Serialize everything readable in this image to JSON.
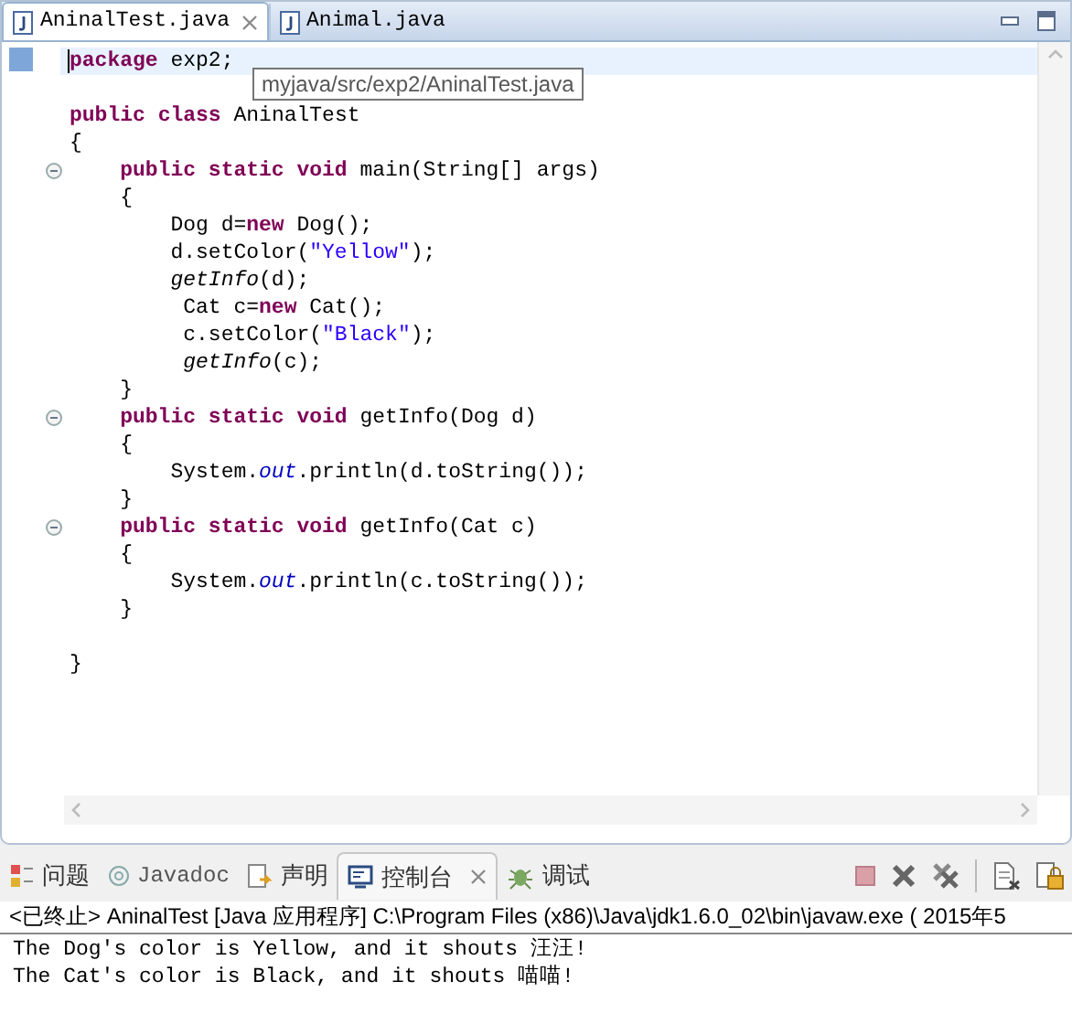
{
  "editor_tabs": [
    {
      "label": "AninalTest.java",
      "selected": true,
      "closable": true
    },
    {
      "label": "Animal.java",
      "selected": false,
      "closable": false
    }
  ],
  "code_lines": [
    {
      "kind": "code",
      "current": true,
      "tokens": [
        {
          "text": "package",
          "kind": "keyword"
        },
        {
          "text": " exp2;",
          "kind": "plain"
        }
      ]
    },
    {
      "kind": "blank"
    },
    {
      "kind": "code",
      "current": false,
      "tokens": [
        {
          "text": "public",
          "kind": "keyword"
        },
        {
          "text": " class",
          "kind": "keyword"
        },
        {
          "text": " AninalTest",
          "kind": "plain"
        }
      ]
    },
    {
      "kind": "code",
      "current": false,
      "tokens": [
        {
          "text": "{",
          "kind": "plain"
        }
      ]
    },
    {
      "kind": "fold_start",
      "current": false,
      "tokens": [
        {
          "text": "    public",
          "kind": "keyword"
        },
        {
          "text": " static",
          "kind": "keyword"
        },
        {
          "text": " void",
          "kind": "keyword"
        },
        {
          "text": " main(String[] args)",
          "kind": "plain"
        }
      ]
    },
    {
      "kind": "code",
      "current": false,
      "tokens": [
        {
          "text": "    {",
          "kind": "plain"
        }
      ]
    },
    {
      "kind": "code",
      "current": false,
      "tokens": [
        {
          "text": "        Dog d=",
          "kind": "plain"
        },
        {
          "text": "new",
          "kind": "keyword"
        },
        {
          "text": " Dog();",
          "kind": "plain"
        }
      ]
    },
    {
      "kind": "code",
      "current": false,
      "tokens": [
        {
          "text": "        d.setColor(",
          "kind": "plain"
        },
        {
          "text": "\"Yellow\"",
          "kind": "string"
        },
        {
          "text": ");",
          "kind": "plain"
        }
      ]
    },
    {
      "kind": "code",
      "current": false,
      "tokens": [
        {
          "text": "        getInfo",
          "kind": "static_call"
        },
        {
          "text": "(d);",
          "kind": "plain"
        }
      ]
    },
    {
      "kind": "code",
      "current": false,
      "tokens": [
        {
          "text": "         Cat c=",
          "kind": "plain"
        },
        {
          "text": "new",
          "kind": "keyword"
        },
        {
          "text": " Cat();",
          "kind": "plain"
        }
      ]
    },
    {
      "kind": "code",
      "current": false,
      "tokens": [
        {
          "text": "         c.setColor(",
          "kind": "plain"
        },
        {
          "text": "\"Black\"",
          "kind": "string"
        },
        {
          "text": ");",
          "kind": "plain"
        }
      ]
    },
    {
      "kind": "code",
      "current": false,
      "tokens": [
        {
          "text": "         getInfo",
          "kind": "static_call"
        },
        {
          "text": "(c);",
          "kind": "plain"
        }
      ]
    },
    {
      "kind": "code",
      "current": false,
      "tokens": [
        {
          "text": "    }",
          "kind": "plain"
        }
      ]
    },
    {
      "kind": "fold_start",
      "current": false,
      "tokens": [
        {
          "text": "    public",
          "kind": "keyword"
        },
        {
          "text": " static",
          "kind": "keyword"
        },
        {
          "text": " void",
          "kind": "keyword"
        },
        {
          "text": " getInfo(Dog d)",
          "kind": "plain"
        }
      ]
    },
    {
      "kind": "code",
      "current": false,
      "tokens": [
        {
          "text": "    {",
          "kind": "plain"
        }
      ]
    },
    {
      "kind": "code",
      "current": false,
      "tokens": [
        {
          "text": "        System.",
          "kind": "plain"
        },
        {
          "text": "out",
          "kind": "static_field"
        },
        {
          "text": ".println(d.toString());",
          "kind": "plain"
        }
      ]
    },
    {
      "kind": "code",
      "current": false,
      "tokens": [
        {
          "text": "    }",
          "kind": "plain"
        }
      ]
    },
    {
      "kind": "fold_start",
      "current": false,
      "tokens": [
        {
          "text": "    public",
          "kind": "keyword"
        },
        {
          "text": " static",
          "kind": "keyword"
        },
        {
          "text": " void",
          "kind": "keyword"
        },
        {
          "text": " getInfo(Cat c)",
          "kind": "plain"
        }
      ]
    },
    {
      "kind": "code",
      "current": false,
      "tokens": [
        {
          "text": "    {",
          "kind": "plain"
        }
      ]
    },
    {
      "kind": "code",
      "current": false,
      "tokens": [
        {
          "text": "        System.",
          "kind": "plain"
        },
        {
          "text": "out",
          "kind": "static_field"
        },
        {
          "text": ".println(c.toString());",
          "kind": "plain"
        }
      ]
    },
    {
      "kind": "code",
      "current": false,
      "tokens": [
        {
          "text": "    }",
          "kind": "plain"
        }
      ]
    },
    {
      "kind": "blank"
    },
    {
      "kind": "code",
      "current": false,
      "tokens": [
        {
          "text": "}",
          "kind": "plain"
        }
      ]
    }
  ],
  "tooltip": "myjava/src/exp2/AninalTest.java",
  "console_tabs": [
    {
      "label": "问题",
      "kind": "problems",
      "selected": false,
      "closable": false
    },
    {
      "label": "Javadoc",
      "kind": "javadoc",
      "selected": false,
      "closable": false
    },
    {
      "label": "声明",
      "kind": "declaration",
      "selected": false,
      "closable": false
    },
    {
      "label": "控制台",
      "kind": "console",
      "selected": true,
      "closable": true
    },
    {
      "label": "调试",
      "kind": "debug",
      "selected": false,
      "closable": false
    }
  ],
  "console_header": "<已终止> AninalTest [Java 应用程序] C:\\Program Files (x86)\\Java\\jdk1.6.0_02\\bin\\javaw.exe ( 2015年5",
  "console_output": [
    "The Dog's color is Yellow, and it shouts 汪汪!",
    "The Cat's color is Black, and it shouts 喵喵!"
  ]
}
